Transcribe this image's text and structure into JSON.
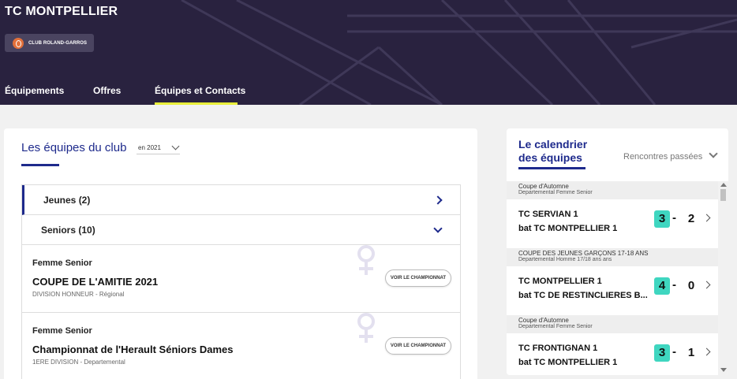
{
  "header": {
    "club_name": "TC MONTPELLIER",
    "badge_label": "CLUB ROLAND-GARROS",
    "nav": [
      {
        "label": "Équipements"
      },
      {
        "label": "Offres"
      },
      {
        "label": "Équipes et Contacts",
        "active": true
      }
    ]
  },
  "teams": {
    "title": "Les équipes du club",
    "year_select": "en 2021",
    "groups": [
      {
        "label": "Jeunes (2)",
        "expanded": false
      },
      {
        "label": "Seniors (10)",
        "expanded": true
      }
    ],
    "items": [
      {
        "category": "Femme Senior",
        "name": "COUPE DE L'AMITIE 2021",
        "division": "DIVISION HONNEUR - Régional",
        "button": "VOIR LE CHAMPIONNAT"
      },
      {
        "category": "Femme Senior",
        "name": "Championnat de l'Herault Séniors Dames",
        "division": "1ERE DIVISION - Departemental",
        "button": "VOIR LE CHAMPIONNAT"
      }
    ]
  },
  "calendar": {
    "title_line1": "Le calendrier",
    "title_line2": "des équipes",
    "filter": "Rencontres passées",
    "matches": [
      {
        "competition": "Coupe d'Automne",
        "category": "Departemental Femme Senior",
        "home": "TC SERVIAN 1",
        "away": "bat TC MONTPELLIER 1",
        "score_winner": "3",
        "score_loser": "2"
      },
      {
        "competition": "COUPE DES JEUNES GARÇONS 17-18 ANS",
        "category": "Departemental Homme 17/18 ans ans",
        "home": "TC MONTPELLIER 1",
        "away": "bat TC DE RESTINCLIERES B...",
        "score_winner": "4",
        "score_loser": "0"
      },
      {
        "competition": "Coupe d'Automne",
        "category": "Departemental Femme Senior",
        "home": "TC FRONTIGNAN 1",
        "away": "bat TC MONTPELLIER 1",
        "score_winner": "3",
        "score_loser": "1"
      }
    ],
    "score_separator": "-"
  },
  "colors": {
    "header_bg": "#29223f",
    "accent_blue": "#1e2a8c",
    "nav_underline": "#e8ee3a",
    "score_win": "#3fd6c0",
    "badge_logo": "#e2703a"
  },
  "icons": {
    "badge": "roland-garros-logo-icon",
    "group_collapsed": "chevron-right-icon",
    "group_expanded": "chevron-down-icon",
    "team_gender": "female-symbol-icon",
    "match_detail": "chevron-right-icon"
  }
}
